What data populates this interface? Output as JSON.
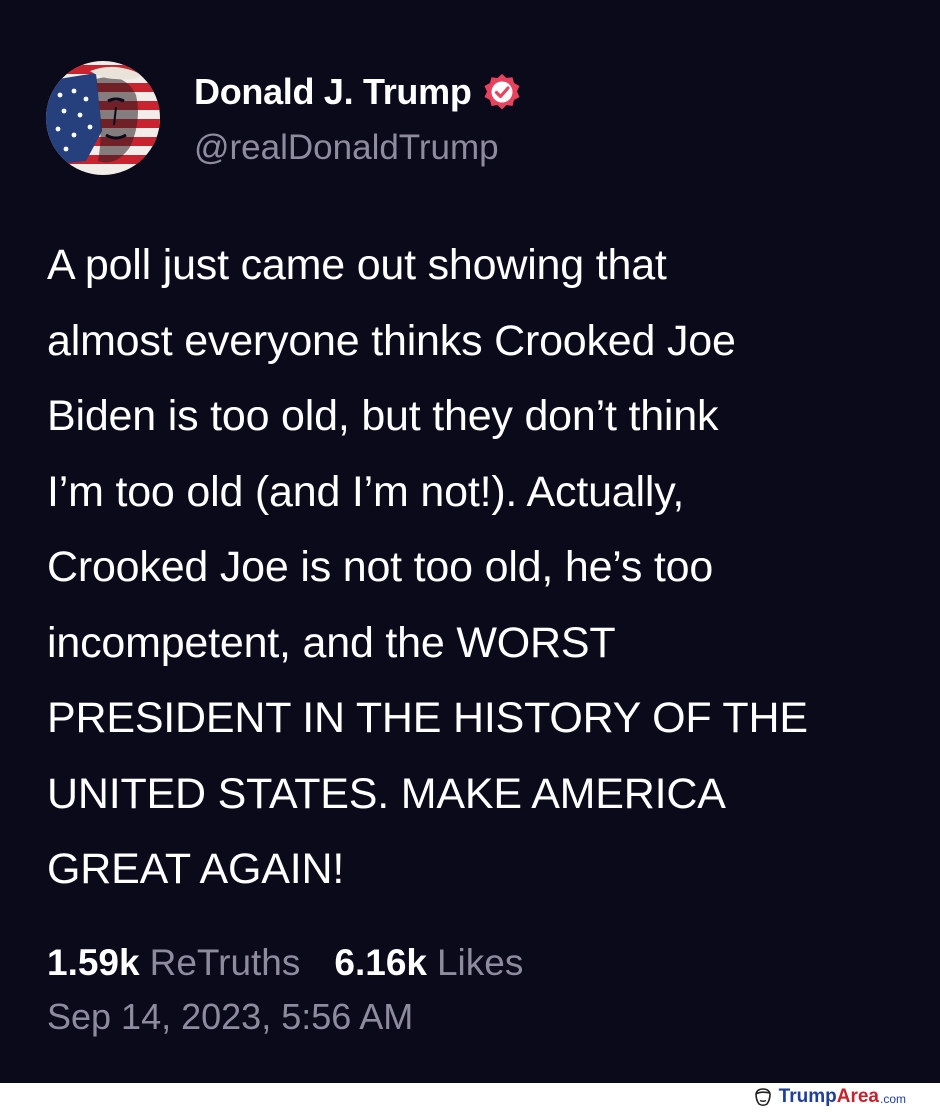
{
  "post": {
    "author": {
      "display_name": "Donald J. Trump",
      "handle": "@realDonaldTrump",
      "verified": true,
      "avatar_icon": "flag-painted-portrait-avatar",
      "badge_icon": "verified-badge-icon"
    },
    "body_lines": [
      "A poll just came out showing that",
      "almost everyone thinks Crooked Joe",
      "Biden is too old, but they don’t think",
      "I’m too old (and I’m not!). Actually,",
      "Crooked Joe is not too old, he’s too",
      "incompetent, and the WORST",
      "PRESIDENT IN THE HISTORY OF THE",
      "UNITED STATES. MAKE AMERICA",
      "GREAT AGAIN!"
    ],
    "stats": {
      "retruths_count": "1.59k",
      "retruths_label": "ReTruths",
      "likes_count": "6.16k",
      "likes_label": "Likes"
    },
    "timestamp": "Sep 14, 2023, 5:56 AM"
  },
  "watermark": {
    "brand_part1": "Trump",
    "brand_part2": "Area",
    "brand_suffix": ".com",
    "icon": "trump-face-outline-icon"
  },
  "colors": {
    "background": "#0b0a1a",
    "text_primary": "#ffffff",
    "text_secondary": "#8f8b9e",
    "verified_badge": "#e8425e",
    "watermark_blue": "#1f3f9c",
    "watermark_red": "#c8202e"
  }
}
